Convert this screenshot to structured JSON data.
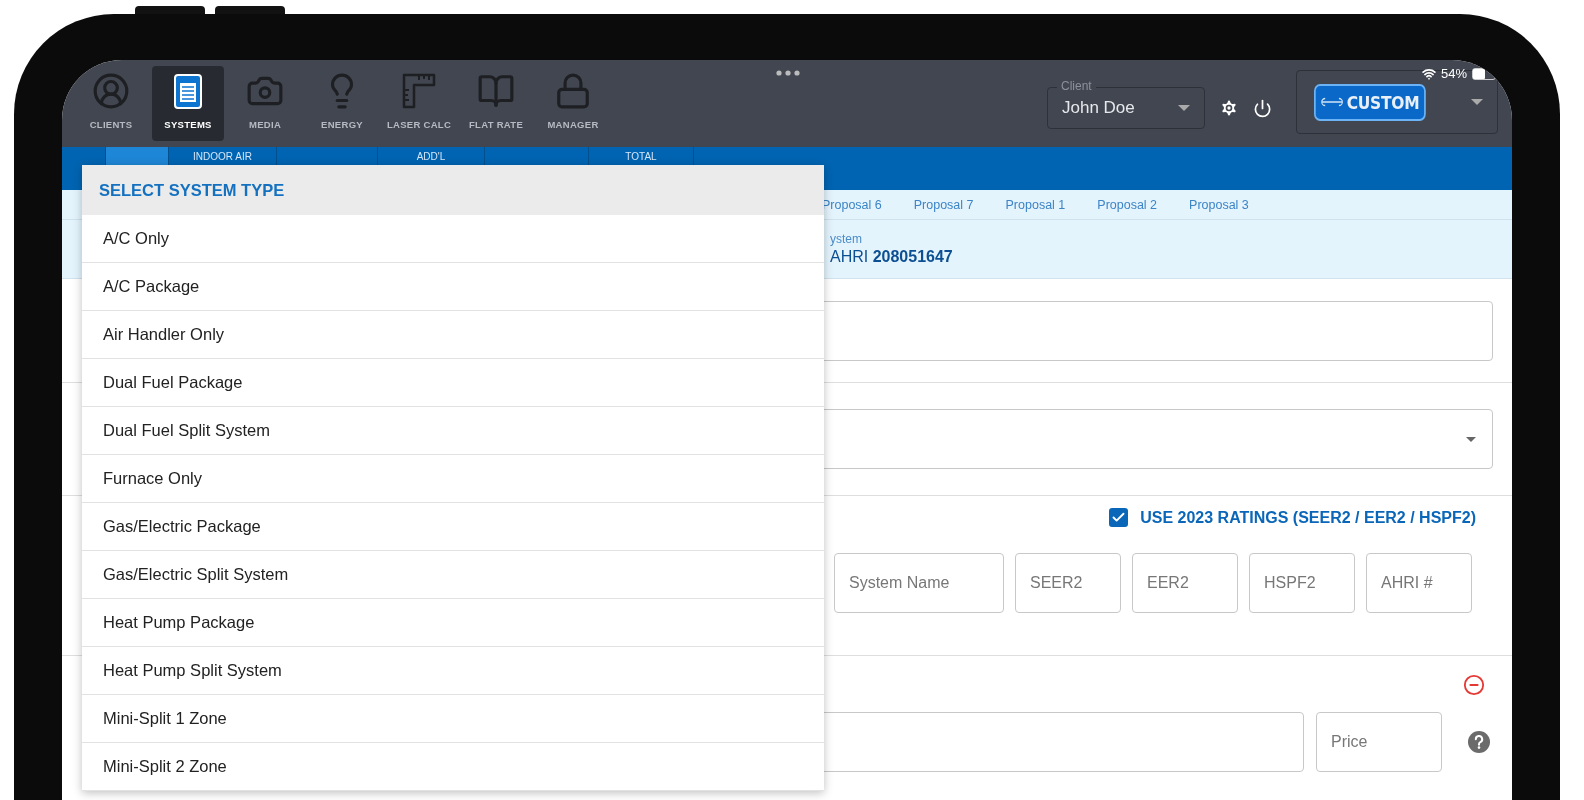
{
  "nav": [
    {
      "label": "CLIENTS",
      "kind": "person",
      "selected": false
    },
    {
      "label": "SYSTEMS",
      "kind": "document",
      "selected": true
    },
    {
      "label": "MEDIA",
      "kind": "camera",
      "selected": false
    },
    {
      "label": "ENERGY",
      "kind": "bulb",
      "selected": false
    },
    {
      "label": "LASER CALC",
      "kind": "ruler",
      "selected": false
    },
    {
      "label": "FLAT RATE",
      "kind": "book",
      "selected": false
    },
    {
      "label": "MANAGER",
      "kind": "lock",
      "selected": false
    }
  ],
  "status_bar": {
    "battery": "54%"
  },
  "client": {
    "label": "Client",
    "value": "John Doe"
  },
  "brand": {
    "label": "CUSTOM"
  },
  "tabs": [
    {
      "selected": true
    },
    {
      "label": "INDOOR AIR",
      "selected": false
    },
    {
      "selected": false
    },
    {
      "label": "ADD'L",
      "selected": false
    },
    {
      "selected": false
    },
    {
      "label": "TOTAL",
      "selected": false
    },
    {
      "selected": false
    }
  ],
  "proposals": [
    "Proposal 6",
    "Proposal 7",
    "Proposal 1",
    "Proposal 2",
    "Proposal 3"
  ],
  "system": {
    "label": "ystem",
    "ahri": "AHRI **208051647**"
  },
  "ratings": {
    "checked": true,
    "label": "USE 2023 RATINGS (SEER2 / EER2 / HSPF2)",
    "fields": [
      {
        "placeholder": "System Name"
      },
      {
        "placeholder": "SEER2"
      },
      {
        "placeholder": "EER2"
      },
      {
        "placeholder": "HSPF2"
      },
      {
        "placeholder": "AHRI #"
      }
    ]
  },
  "price": {
    "placeholder": "Price"
  },
  "dropdown": {
    "title": "SELECT SYSTEM TYPE",
    "options": [
      "A/C Only",
      "A/C Package",
      "Air Handler Only",
      "Dual Fuel Package",
      "Dual Fuel Split System",
      "Furnace Only",
      "Gas/Electric Package",
      "Gas/Electric Split System",
      "Heat Pump Package",
      "Heat Pump Split System",
      "Mini-Split 1 Zone",
      "Mini-Split 2 Zone"
    ]
  }
}
